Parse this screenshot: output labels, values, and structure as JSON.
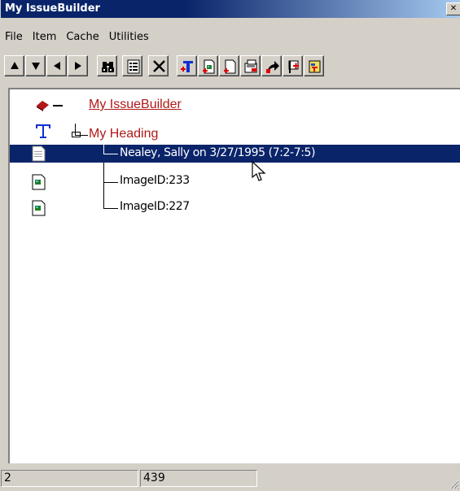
{
  "window": {
    "title": "My IssueBuilder",
    "close_glyph": "✕"
  },
  "menu": [
    "File",
    "Item",
    "Cache",
    "Utilities"
  ],
  "toolbar": [
    {
      "name": "move-up-icon"
    },
    {
      "name": "move-down-icon"
    },
    {
      "name": "move-left-icon"
    },
    {
      "name": "move-right-icon"
    },
    {
      "name": "binoculars-icon"
    },
    {
      "name": "properties-icon"
    },
    {
      "name": "delete-icon"
    },
    {
      "name": "add-heading-icon"
    },
    {
      "name": "add-image-icon"
    },
    {
      "name": "add-document-icon"
    },
    {
      "name": "import-icon"
    },
    {
      "name": "export-icon"
    },
    {
      "name": "flag-icon"
    },
    {
      "name": "special-icon"
    }
  ],
  "tree": {
    "root": "My IssueBuilder",
    "heading": "My Heading",
    "items": [
      {
        "label": "Nealey, Sally on 3/27/1995 (7:2-7:5)",
        "icon": "document-icon",
        "selected": true
      },
      {
        "label": "ImageID:233",
        "icon": "image-document-icon",
        "selected": false
      },
      {
        "label": "ImageID:227",
        "icon": "image-document-icon",
        "selected": false
      }
    ]
  },
  "status": {
    "left": "2",
    "right": "439"
  },
  "colors": {
    "selection": "#0a246a",
    "tree_link": "#b01818",
    "face": "#d4d0c8"
  }
}
